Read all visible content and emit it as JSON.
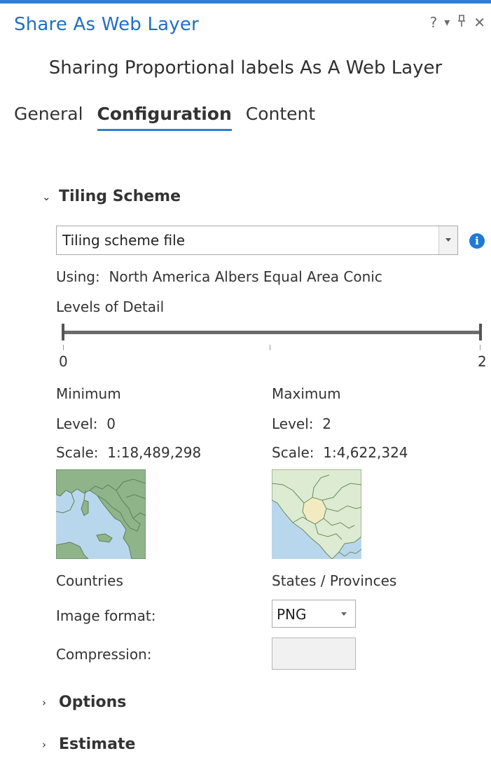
{
  "pane": {
    "title": "Share As Web Layer",
    "controls": {
      "help": "?",
      "menu": "▾",
      "pin": "д",
      "close": "✕"
    }
  },
  "subtitle": "Sharing Proportional labels As A Web Layer",
  "tabs": [
    {
      "label": "General",
      "active": false
    },
    {
      "label": "Configuration",
      "active": true
    },
    {
      "label": "Content",
      "active": false
    }
  ],
  "tiling": {
    "header": "Tiling Scheme",
    "scheme_value": "Tiling scheme file",
    "using_label": "Using:",
    "using_value": "North America Albers Equal Area Conic",
    "lod_label": "Levels of Detail",
    "slider": {
      "min": "0",
      "max": "2",
      "min_level": 0,
      "max_level": 2
    },
    "minimum": {
      "header": "Minimum",
      "level_label": "Level:",
      "level": "0",
      "scale_label": "Scale:",
      "scale": "1:18,489,298",
      "caption": "Countries"
    },
    "maximum": {
      "header": "Maximum",
      "level_label": "Level:",
      "level": "2",
      "scale_label": "Scale:",
      "scale": "1:4,622,324",
      "caption": "States / Provinces"
    },
    "image_format_label": "Image format:",
    "image_format_value": "PNG",
    "compression_label": "Compression:",
    "compression_value": ""
  },
  "sections": {
    "options": "Options",
    "estimate": "Estimate"
  },
  "colors": {
    "accent": "#2f7fd1",
    "land": "#8fb48a",
    "water": "#b9d7ec",
    "province": "#dcebd2",
    "highlight": "#f2ebc2"
  }
}
